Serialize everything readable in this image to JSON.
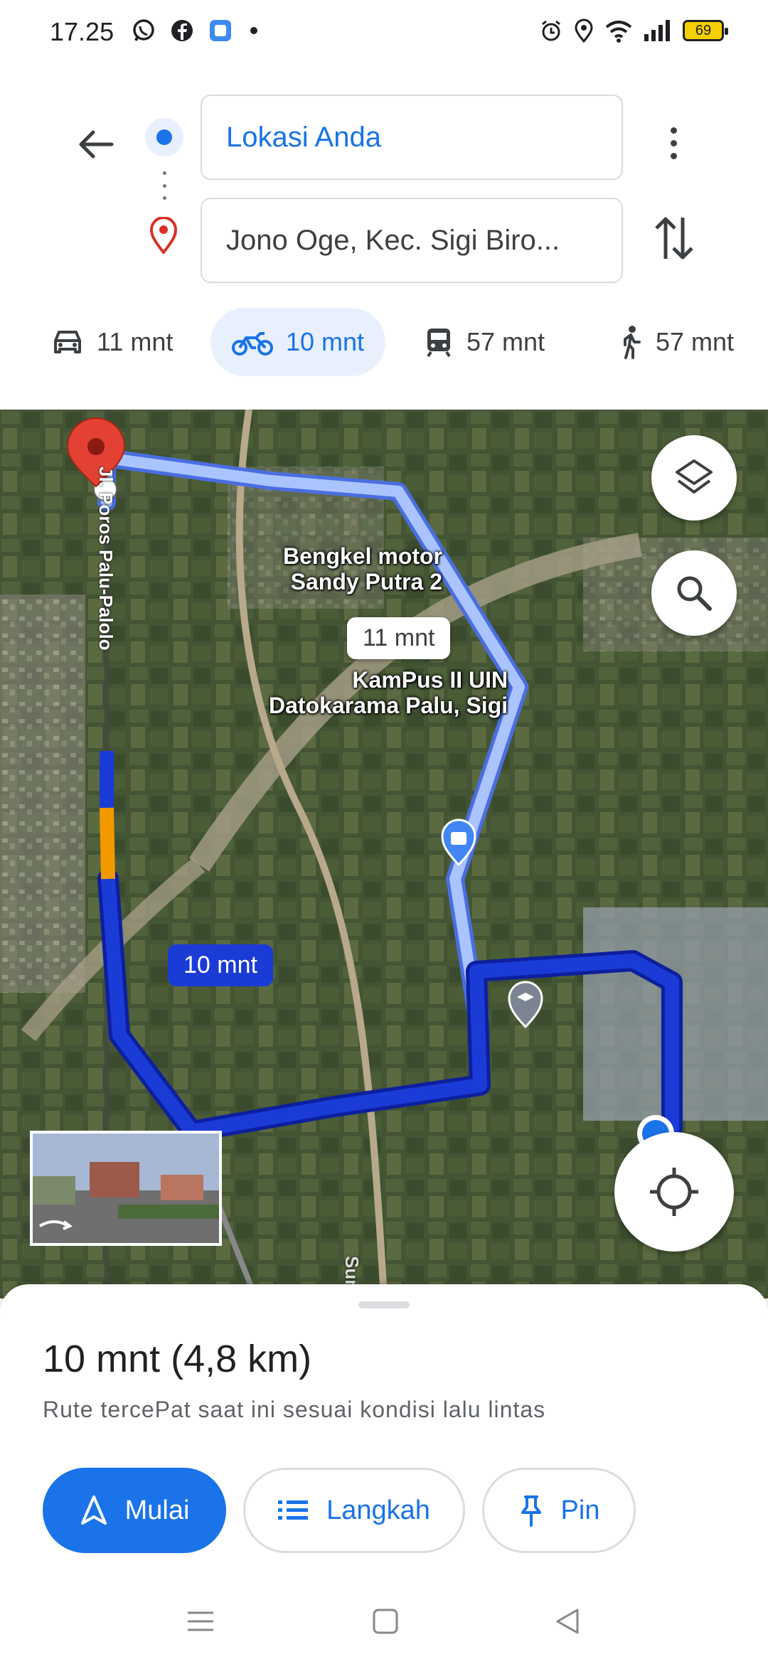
{
  "status_bar": {
    "time": "17.25",
    "battery_level": "69",
    "left_icons": [
      "whatsapp-icon",
      "facebook-icon",
      "app-icon",
      "notification-dot-icon"
    ],
    "right_icons": [
      "alarm-icon",
      "location-icon",
      "wifi-icon",
      "signal-icon",
      "battery-icon"
    ]
  },
  "directions": {
    "origin": "Lokasi Anda",
    "destination": "Jono Oge, Kec. Sigi Biro..."
  },
  "travel_modes": [
    {
      "mode": "car",
      "icon": "car-icon",
      "time": "11 mnt",
      "selected": false
    },
    {
      "mode": "motorcycle",
      "icon": "motorcycle-icon",
      "time": "10 mnt",
      "selected": true
    },
    {
      "mode": "transit",
      "icon": "train-icon",
      "time": "57 mnt",
      "selected": false
    },
    {
      "mode": "walk",
      "icon": "walking-icon",
      "time": "57 mnt",
      "selected": false
    }
  ],
  "map": {
    "road_label": "Jl. Poros Palu-Palolo",
    "road_label_2": "Sura",
    "alt_route_label": "11 mnt",
    "main_route_label": "10 mnt",
    "poi_1": {
      "line1": "Bengkel motor",
      "line2": "Sandy Putra 2",
      "icon": "shopping-bag-icon"
    },
    "poi_2": {
      "line1": "KamPus II UIN",
      "line2": "Datokarama Palu, Sigi",
      "icon": "graduation-cap-icon"
    },
    "route_color": "#1a3bd6",
    "alt_route_color": "#8ab4f8"
  },
  "sheet": {
    "summary": "10 mnt (4,8 km)",
    "subtitle": "Rute tercePat saat ini sesuai kondisi lalu lintas",
    "start_label": "Mulai",
    "steps_label": "Langkah",
    "pin_label": "Pin"
  },
  "accent_color": "#1a73e8"
}
